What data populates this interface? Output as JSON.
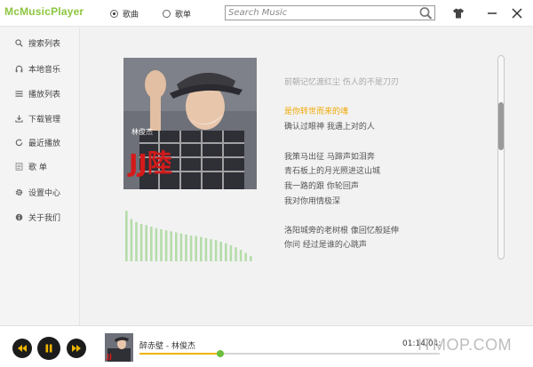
{
  "app": {
    "title": "McMusicPlayer",
    "accent": "#8dc63f",
    "highlight": "#f0a800"
  },
  "header": {
    "mode_options": [
      {
        "label": "歌曲",
        "selected": true
      },
      {
        "label": "歌单",
        "selected": false
      }
    ],
    "search": {
      "placeholder": "Search Music",
      "value": "",
      "icon": "search-icon"
    },
    "buttons": [
      {
        "name": "skin",
        "icon": "tshirt-icon"
      },
      {
        "name": "minimize",
        "icon": "minimize-icon"
      },
      {
        "name": "close",
        "icon": "close-icon"
      }
    ]
  },
  "sidebar": {
    "items": [
      {
        "label": "搜索列表",
        "icon": "search-icon"
      },
      {
        "label": "本地音乐",
        "icon": "headphones-icon"
      },
      {
        "label": "播放列表",
        "icon": "list-icon"
      },
      {
        "label": "下载管理",
        "icon": "download-icon"
      },
      {
        "label": "最近播放",
        "icon": "history-icon"
      },
      {
        "label": "歌 单",
        "icon": "playlist-icon"
      },
      {
        "label": "设置中心",
        "icon": "gear-icon"
      },
      {
        "label": "关于我们",
        "icon": "info-icon"
      }
    ]
  },
  "cover": {
    "artist_text": "林俊杰",
    "title_text": "JJ陸"
  },
  "spectrum": {
    "levels": [
      0.98,
      0.82,
      0.76,
      0.72,
      0.7,
      0.67,
      0.64,
      0.62,
      0.6,
      0.58,
      0.56,
      0.54,
      0.52,
      0.5,
      0.49,
      0.47,
      0.45,
      0.43,
      0.41,
      0.38,
      0.35,
      0.31,
      0.27,
      0.22,
      0.16,
      0.1
    ]
  },
  "lyrics": [
    {
      "text": "前朝记忆渡红尘 伤人的不是刀刃",
      "state": "dim"
    },
    {
      "text": "是你转世而来的魂",
      "state": "current"
    },
    {
      "text": "确认过眼神 我遇上对的人",
      "state": "normal"
    },
    {
      "text": "我策马出征 马蹄声如泪奔",
      "state": "normal"
    },
    {
      "text": "青石板上的月光照进这山城",
      "state": "normal"
    },
    {
      "text": "我一路的跟 你轮回声",
      "state": "normal"
    },
    {
      "text": "我对你用情极深",
      "state": "normal"
    },
    {
      "text": "洛阳城旁的老树根 像回忆般延伸",
      "state": "normal"
    },
    {
      "text": "你问 经过是谁的心跳声",
      "state": "normal"
    }
  ],
  "lyrics_scroll": {
    "position": 0.3
  },
  "player": {
    "controls": [
      {
        "name": "previous",
        "icon": "previous-icon"
      },
      {
        "name": "pause",
        "icon": "pause-icon"
      },
      {
        "name": "next",
        "icon": "next-icon"
      }
    ],
    "track": "醉赤壁 - 林俊杰",
    "elapsed": "01:14",
    "total": "04:",
    "progress": 0.27,
    "watermark": "ITMOP.COM"
  }
}
